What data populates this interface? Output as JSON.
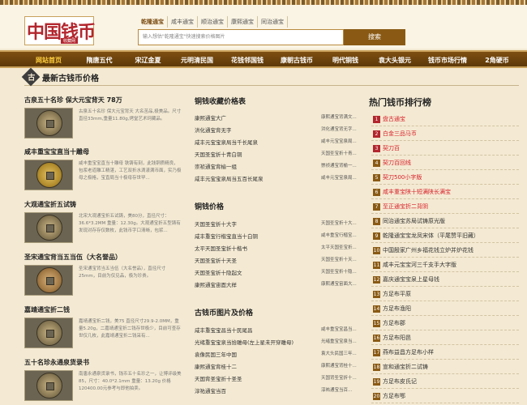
{
  "logo": {
    "main": "中国钱币",
    "sub": "收藏网"
  },
  "search": {
    "tabs": [
      "乾隆通宝",
      "咸丰通宝",
      "顺治通宝",
      "康熙通宝",
      "同治通宝"
    ],
    "placeholder": "输入想估\"乾隆通宝\"快速搜索价格图片",
    "button": "搜索"
  },
  "nav": [
    "网站首页",
    "隋唐五代",
    "宋辽金夏",
    "元明清民国",
    "花钱邻国钱",
    "康朝古钱币",
    "明代铜钱",
    "袁大头银元",
    "钱币市场行情",
    "2角硬币"
  ],
  "section_title": "最新古钱币价格",
  "coins": [
    {
      "title": "古泉五十名珍 保大元宝背天 78万",
      "desc": "古泉五十名珍 保大元宝背天 大名苦品,极美品。尺寸直径33mm,重量11.80g,烤堂艺术珂藏品。"
    },
    {
      "title": "咸丰重宝宝直当十雕母",
      "desc": "咸丰重宝宝直当十雕母 铁铸有刻，此钱铜质精良，包浆老道雕工精湛，工艺双折水滴漾满币面，实乃极母之极格，宝直局当十极母存世罕..."
    },
    {
      "title": "大观通宝折五试铸",
      "desc": "北宋大观通宝折五试铸，美80分，直径尺寸：36.6*3.2MM 重量：12.30g。大观通宝折五型铸有发现对存存仅数枚，此钱币字口清晰，包浆..."
    },
    {
      "title": "圣宋通宝背当五当伍（大名誉品）",
      "desc": "圣宋通宝背当五当伍（大名誉品），直径尺寸25mm，目前为仅见品，极为珍贵。"
    },
    {
      "title": "嘉靖通宝折二钱",
      "desc": "嘉靖通宝折二钱，美75 直径尺寸29.9-2.0MM，重量5.20g，二嘉靖通宝折二钱存世极少，目前可查存世仅几枚，此嘉靖通宝折二钱采有..."
    },
    {
      "title": "五十名珍永通泉货录书",
      "desc": "南唐永通泉货录书，钱币五十名珍之一，让博评级美85，尺寸：40.0*2.1mm 重量：13.20g 价格120400.00元参考与即他拍卖。"
    }
  ],
  "mid_sections": [
    {
      "title": "铜钱收藏价格表",
      "items": [
        {
          "name": "康熙通宝大广",
          "price": "康熙通宝背满文..."
        },
        {
          "name": "洪化通宝背无字",
          "price": "洪化通宝背无字..."
        },
        {
          "name": "咸丰元宝宝泉局当千长尾泉",
          "price": "咸丰元宝宝泉局..."
        },
        {
          "name": "天国圣宝折十青白铜",
          "price": "天国圣宝折十青..."
        },
        {
          "name": "崇祯通宝背榆一组",
          "price": "崇祯通宝背榆一..."
        },
        {
          "name": "咸丰元宝宝泉局当五百长尾泉",
          "price": "咸丰元宝宝泉局..."
        }
      ]
    },
    {
      "title": "铜钱价格",
      "items": [
        {
          "name": "天国圣宝折十大字",
          "price": "天国圣宝折十大..."
        },
        {
          "name": "咸丰重宝行楷宝直当十白铜",
          "price": "咸丰重宝行楷宝..."
        },
        {
          "name": "太平天国圣宝折十楷书",
          "price": "太平天国圣宝折..."
        },
        {
          "name": "天国圣宝折十天圣",
          "price": "天国圣宝折十天..."
        },
        {
          "name": "天国圣宝折十隐起文",
          "price": "天国圣宝折十隐..."
        },
        {
          "name": "康熙通宝宙面大样",
          "price": "康熙通宝宙面大..."
        }
      ]
    },
    {
      "title": "古钱币图片及价格",
      "items": [
        {
          "name": "咸丰重宝宝昌当十民尾昌",
          "price": "咸丰重宝宝昌当..."
        },
        {
          "name": "光绪重宝宝泉当拾雕母(左上星未开穿雕母)",
          "price": "光绪重宝宝泉当..."
        },
        {
          "name": "袁像民国三年中国",
          "price": "袁大头民国三年..."
        },
        {
          "name": "康熙通宝背桂十二",
          "price": "康熙通宝背桂十..."
        },
        {
          "name": "天国背圣宝折十圣圣",
          "price": "天国背圣宝折十..."
        },
        {
          "name": "淳祐通宝当百",
          "price": "淳祐通宝当百..."
        }
      ]
    }
  ],
  "ranking": {
    "title": "热门钱币排行榜",
    "items": [
      {
        "num": "1",
        "name": "盘古通宝",
        "color": "#d8202a"
      },
      {
        "num": "2",
        "name": "白金三品马币",
        "color": "#d8202a"
      },
      {
        "num": "3",
        "name": "契刀百",
        "color": "#d8202a"
      },
      {
        "num": "4",
        "name": "契刀百回线",
        "color": "#d8202a"
      },
      {
        "num": "5",
        "name": "契刀500小字版",
        "color": "#d8202a"
      },
      {
        "num": "6",
        "name": "咸丰重宝陕十短满陕长满宝",
        "color": "#d8202a"
      },
      {
        "num": "7",
        "name": "至正通宝折二背阴",
        "color": "#d8202a"
      },
      {
        "num": "8",
        "name": "同治通宝苏局试铸原光版",
        "color": "#333333"
      },
      {
        "num": "9",
        "name": "乾隆通宝宝龙凤宋体（平尾赞平旧藏）",
        "color": "#333333"
      },
      {
        "num": "10",
        "name": "中国殷家广州乡福花钱立炉并炉花钱",
        "color": "#333333"
      },
      {
        "num": "11",
        "name": "咸丰元宝宝河三千支手大字版",
        "color": "#333333"
      },
      {
        "num": "12",
        "name": "嘉庆通宝宝泉上星母钱",
        "color": "#333333"
      },
      {
        "num": "13",
        "name": "方足布平原",
        "color": "#333333"
      },
      {
        "num": "14",
        "name": "方足布渔阳",
        "color": "#333333"
      },
      {
        "num": "15",
        "name": "方足布郡",
        "color": "#333333"
      },
      {
        "num": "16",
        "name": "方足布阳邑",
        "color": "#333333"
      },
      {
        "num": "17",
        "name": "燕布益昌方足布小样",
        "color": "#333333"
      },
      {
        "num": "18",
        "name": "宣和通宝折二试铸",
        "color": "#333333"
      },
      {
        "num": "19",
        "name": "方足布皮氏记",
        "color": "#333333"
      },
      {
        "num": "20",
        "name": "方足布鄂",
        "color": "#333333"
      }
    ]
  }
}
